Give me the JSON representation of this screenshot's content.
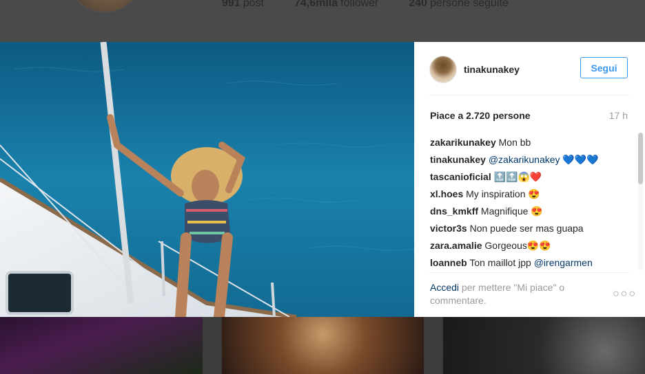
{
  "profile": {
    "stats": [
      {
        "value": "991",
        "label": "post"
      },
      {
        "value": "74,6mila",
        "label": "follower"
      },
      {
        "value": "240",
        "label": "persone seguite"
      }
    ]
  },
  "post": {
    "username": "tinakunakey",
    "follow_label": "Segui",
    "likes_text": "Piace a 2.720 persone",
    "time": "17 h",
    "comments": [
      {
        "user": "zakarikunakey",
        "text": "Mon bb",
        "mention": "",
        "emoji": ""
      },
      {
        "user": "tinakunakey",
        "text": "",
        "mention": "@zakarikunakey",
        "emoji": "💙💙💙"
      },
      {
        "user": "tascanioficial",
        "text": "",
        "mention": "",
        "emoji": "🔝🔝😱❤️"
      },
      {
        "user": "xl.hoes",
        "text": "My inspiration",
        "mention": "",
        "emoji": "😍"
      },
      {
        "user": "dns_kmkff",
        "text": "Magnifique",
        "mention": "",
        "emoji": "😍"
      },
      {
        "user": "victor3s",
        "text": "Non puede ser mas guapa",
        "mention": "",
        "emoji": ""
      },
      {
        "user": "zara.amalie",
        "text": "Gorgeous",
        "mention": "",
        "emoji": "😍😍"
      },
      {
        "user": "loanneb",
        "text": "Ton maillot jpp",
        "mention": "@irengarmen",
        "emoji": ""
      }
    ],
    "login_link": "Accedi",
    "login_rest": " per mettere \"Mi piace\" o commentare.",
    "more_icon": "more-options-icon"
  },
  "colors": {
    "accent": "#3897f0",
    "link": "#003569",
    "muted": "#999999"
  }
}
